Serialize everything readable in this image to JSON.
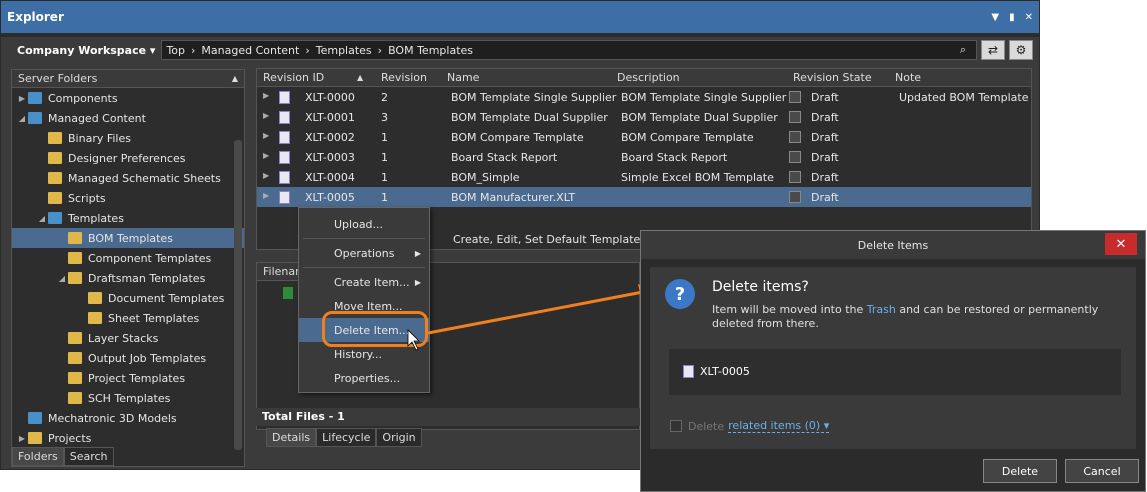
{
  "window": {
    "title": "Explorer"
  },
  "pathbar": {
    "workspace": "Company Workspace ▾",
    "crumbs": [
      "Top",
      "Managed Content",
      "Templates",
      "BOM Templates"
    ]
  },
  "left": {
    "header": "Server Folders",
    "items": [
      {
        "label": "Components",
        "indent": 0,
        "arrow": "▶",
        "icon": "f-blue"
      },
      {
        "label": "Managed Content",
        "indent": 0,
        "arrow": "◢",
        "icon": "f-blue"
      },
      {
        "label": "Binary Files",
        "indent": 1,
        "arrow": "",
        "icon": "f-yellow"
      },
      {
        "label": "Designer Preferences",
        "indent": 1,
        "arrow": "",
        "icon": "f-yellow"
      },
      {
        "label": "Managed Schematic Sheets",
        "indent": 1,
        "arrow": "",
        "icon": "f-yellow"
      },
      {
        "label": "Scripts",
        "indent": 1,
        "arrow": "",
        "icon": "f-yellow"
      },
      {
        "label": "Templates",
        "indent": 1,
        "arrow": "◢",
        "icon": "f-blue"
      },
      {
        "label": "BOM Templates",
        "indent": 2,
        "arrow": "",
        "icon": "f-yellow"
      },
      {
        "label": "Component Templates",
        "indent": 2,
        "arrow": "",
        "icon": "f-yellow"
      },
      {
        "label": "Draftsman Templates",
        "indent": 2,
        "arrow": "◢",
        "icon": "f-yellow"
      },
      {
        "label": "Document Templates",
        "indent": 3,
        "arrow": "",
        "icon": "f-yellow"
      },
      {
        "label": "Sheet Templates",
        "indent": 3,
        "arrow": "",
        "icon": "f-yellow"
      },
      {
        "label": "Layer Stacks",
        "indent": 2,
        "arrow": "",
        "icon": "f-yellow"
      },
      {
        "label": "Output Job Templates",
        "indent": 2,
        "arrow": "",
        "icon": "f-yellow"
      },
      {
        "label": "Project Templates",
        "indent": 2,
        "arrow": "",
        "icon": "f-yellow"
      },
      {
        "label": "SCH Templates",
        "indent": 2,
        "arrow": "",
        "icon": "f-yellow"
      },
      {
        "label": "Mechatronic 3D Models",
        "indent": 0,
        "arrow": "",
        "icon": "f-blue"
      },
      {
        "label": "Projects",
        "indent": 0,
        "arrow": "▶",
        "icon": "f-yellow"
      }
    ],
    "selected_item": "BOM Templates",
    "tabs": [
      "Folders",
      "Search"
    ]
  },
  "grid": {
    "columns": [
      "Revision ID",
      "Revision",
      "Name",
      "Description",
      "Revision State",
      "Note"
    ],
    "rows": [
      {
        "id": "XLT-0000",
        "rev": "2",
        "name": "BOM Template Single Supplier",
        "desc": "BOM Template Single Supplier",
        "state": "Draft",
        "note": "Updated BOM Template"
      },
      {
        "id": "XLT-0001",
        "rev": "3",
        "name": "BOM Template Dual Supplier",
        "desc": "BOM Template Dual Supplier",
        "state": "Draft",
        "note": ""
      },
      {
        "id": "XLT-0002",
        "rev": "1",
        "name": "BOM Compare Template",
        "desc": "BOM Compare Template",
        "state": "Draft",
        "note": ""
      },
      {
        "id": "XLT-0003",
        "rev": "1",
        "name": "Board Stack Report",
        "desc": "Board Stack Report",
        "state": "Draft",
        "note": ""
      },
      {
        "id": "XLT-0004",
        "rev": "1",
        "name": "BOM_Simple",
        "desc": "Simple Excel BOM Template",
        "state": "Draft",
        "note": ""
      },
      {
        "id": "XLT-0005",
        "rev": "1",
        "name": "BOM Manufacturer.XLT",
        "desc": "",
        "state": "Draft",
        "note": ""
      }
    ],
    "selected_row": "XLT-0005",
    "footer_text": "Create, Edit, Set Default Templates in"
  },
  "sub": {
    "header": "Filenam",
    "totals": "Total Files - 1",
    "tabs": [
      "Details",
      "Lifecycle",
      "Origin"
    ]
  },
  "context_menu": [
    {
      "label": "Upload...",
      "submenu": false
    },
    {
      "sep": true
    },
    {
      "label": "Operations",
      "submenu": true
    },
    {
      "sep": true
    },
    {
      "label": "Create Item...",
      "submenu": true
    },
    {
      "label": "Move Item...",
      "submenu": false
    },
    {
      "label": "Delete Item...",
      "submenu": false,
      "hl": true
    },
    {
      "label": "History...",
      "submenu": false
    },
    {
      "label": "Properties...",
      "submenu": false
    }
  ],
  "dialog": {
    "title": "Delete Items",
    "close": "✕",
    "heading": "Delete items?",
    "text_before": "Item will be moved into the ",
    "text_link": "Trash",
    "text_after": " and can be restored or permanently deleted from there.",
    "item": "XLT-0005",
    "check_label": "Delete",
    "check_link": "related items (0) ▾",
    "delete_btn": "Delete",
    "cancel_btn": "Cancel"
  },
  "colors": {
    "accent": "#f07f1e",
    "selection": "#4a6b8f",
    "titlebar": "#3d6ea5"
  }
}
